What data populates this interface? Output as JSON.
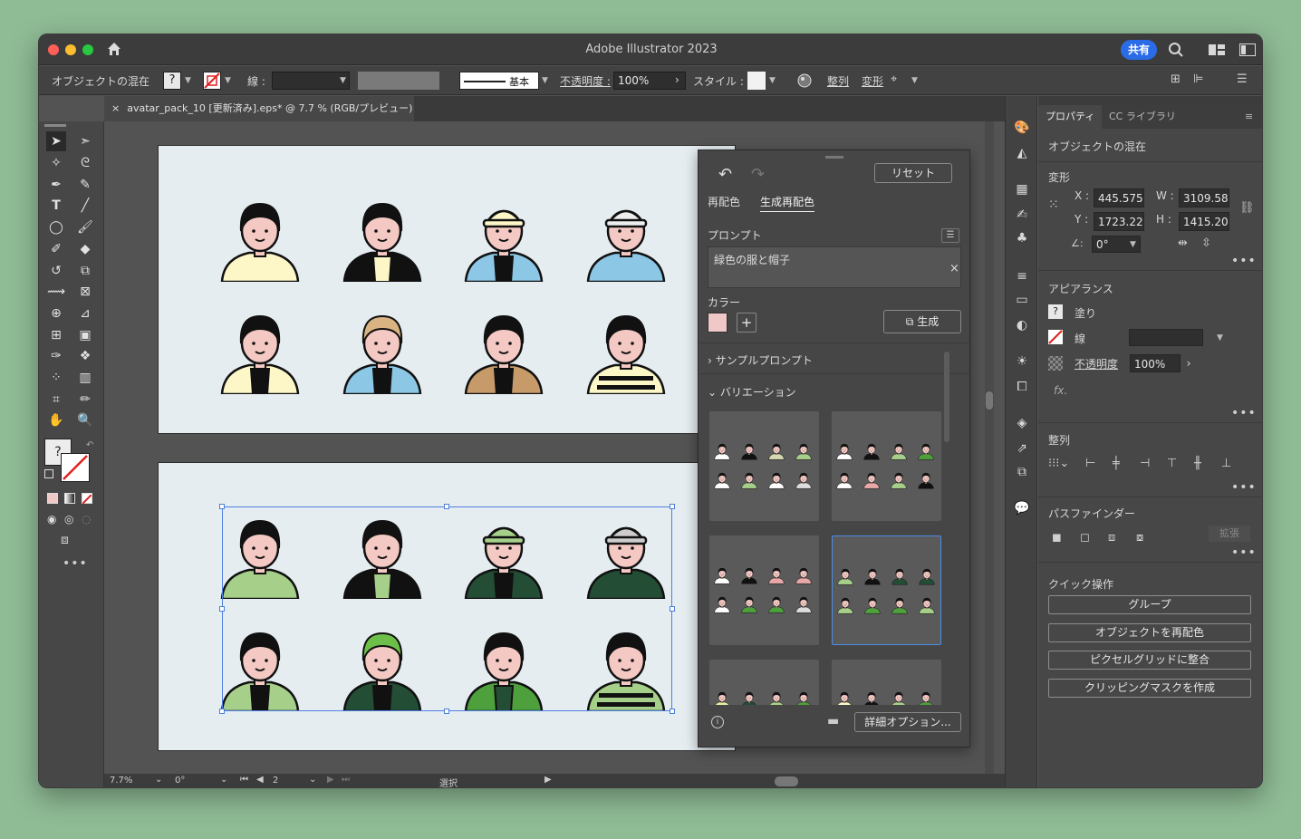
{
  "window": {
    "title": "Adobe Illustrator 2023",
    "share_label": "共有"
  },
  "control_bar": {
    "selection_label": "オブジェクトの混在",
    "stroke_label": "線 :",
    "stroke_style": "基本",
    "opacity_label": "不透明度 :",
    "opacity_value": "100%",
    "style_label": "スタイル :",
    "align_label": "整列",
    "transform_label": "変形"
  },
  "document_tab": {
    "label": "avatar_pack_10 [更新済み].eps* @ 7.7 % (RGB/プレビュー)"
  },
  "status_bar": {
    "zoom": "7.7%",
    "rotation": "0°",
    "artboard_number": "2",
    "mode": "選択"
  },
  "recolor_panel": {
    "reset_label": "リセット",
    "tab_recolor": "再配色",
    "tab_generative": "生成再配色",
    "prompt_label": "プロンプト",
    "prompt_value": "緑色の服と帽子",
    "color_label": "カラー",
    "generate_label": "生成",
    "sample_prompts_label": "サンプルプロンプト",
    "variations_label": "バリエーション",
    "advanced_options_label": "詳細オプション..."
  },
  "properties_panel": {
    "tab_properties": "プロパティ",
    "tab_cc_libraries": "CC ライブラリ",
    "selection_type": "オブジェクトの混在",
    "transform_title": "変形",
    "x_label": "X :",
    "x_value": "445.575",
    "y_label": "Y :",
    "y_value": "1723.22",
    "w_label": "W :",
    "w_value": "3109.58",
    "h_label": "H :",
    "h_value": "1415.20",
    "angle_value": "0°",
    "appearance_title": "アピアランス",
    "fill_label": "塗り",
    "stroke_label": "線",
    "opacity_label": "不透明度",
    "opacity_value": "100%",
    "fx_label": "fx.",
    "align_title": "整列",
    "pathfinder_title": "パスファインダー",
    "expand_label": "拡張",
    "quick_actions_title": "クイック操作",
    "quick_actions": [
      "グループ",
      "オブジェクトを再配色",
      "ピクセルグリッドに整合",
      "クリッピングマスクを作成"
    ]
  },
  "colors": {
    "accent_blue": "#2b6be8",
    "swatch_pink": "#f0c8c8",
    "green_light": "#a6d08a",
    "green_dark": "#234d34",
    "green_mid": "#4da03c"
  },
  "artboard_top_avatars": [
    {
      "shirt": "#fdf7c8",
      "hair": "#111111",
      "hat": ""
    },
    {
      "shirt": "#111111",
      "hair": "#111111",
      "hat": "",
      "inner": "#fdf7c8"
    },
    {
      "shirt": "#8cc7e5",
      "hair": "#111111",
      "hat": "#fdf7c8",
      "inner": "#111111"
    },
    {
      "shirt": "#8cc7e5",
      "hair": "#111111",
      "hat": "#eeeeee"
    },
    {
      "shirt": "#fdf7c8",
      "hair": "#111111",
      "hat": "",
      "inner": "#111111"
    },
    {
      "shirt": "#8cc7e5",
      "hair": "#d9b382",
      "hat": "",
      "inner": "#111111"
    },
    {
      "shirt": "#c79a6a",
      "hair": "#111111",
      "hat": "",
      "inner": "#111111"
    },
    {
      "shirt": "#fdf7c8",
      "hair": "#111111",
      "hat": "",
      "striped": true
    }
  ],
  "artboard_bottom_avatars": [
    {
      "shirt": "#a6d08a",
      "hair": "#111111",
      "hat": ""
    },
    {
      "shirt": "#111111",
      "hair": "#111111",
      "hat": "",
      "inner": "#a6d08a"
    },
    {
      "shirt": "#234d34",
      "hair": "#111111",
      "hat": "#a6d08a",
      "inner": "#111111"
    },
    {
      "shirt": "#234d34",
      "hair": "#111111",
      "hat": "#cccccc"
    },
    {
      "shirt": "#a6d08a",
      "hair": "#111111",
      "hat": "",
      "inner": "#111111"
    },
    {
      "shirt": "#234d34",
      "hair": "#6cc04a",
      "hat": "",
      "inner": "#111111"
    },
    {
      "shirt": "#4da03c",
      "hair": "#111111",
      "hat": "",
      "inner": "#234d34"
    },
    {
      "shirt": "#a6d08a",
      "hair": "#111111",
      "hat": "",
      "striped": true
    }
  ],
  "variation_palettes": [
    [
      "#ffffff",
      "#111111",
      "#d8d8b0",
      "#a6d08a",
      "#ffffff",
      "#a6d08a",
      "#ffffff",
      "#dddddd"
    ],
    [
      "#ffffff",
      "#111111",
      "#a6d08a",
      "#4da03c",
      "#ffffff",
      "#e8a8a8",
      "#a6d08a",
      "#111111"
    ],
    [
      "#ffffff",
      "#111111",
      "#e8a8a8",
      "#e8a8a8",
      "#ffffff",
      "#4da03c",
      "#4da03c",
      "#dddddd"
    ],
    [
      "#a6d08a",
      "#111111",
      "#234d34",
      "#234d34",
      "#a6d08a",
      "#4da03c",
      "#4da03c",
      "#a6d08a"
    ],
    [
      "#e8f0a0",
      "#234d34",
      "#a6d08a",
      "#4da03c"
    ],
    [
      "#fdf7c8",
      "#111111",
      "#a6d08a",
      "#4da03c"
    ]
  ]
}
